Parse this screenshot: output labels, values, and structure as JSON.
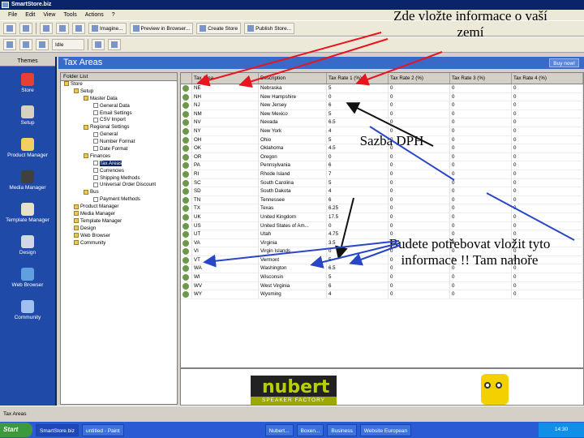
{
  "window": {
    "title": "SmartStore.biz"
  },
  "menu": [
    "File",
    "Edit",
    "View",
    "Tools",
    "Actions",
    "?"
  ],
  "toolbar1": {
    "buttons": [
      "Imagine...",
      "Preview in Browser...",
      "Create Store",
      "Publish Store..."
    ]
  },
  "toolbar2": {
    "dropdown": "Idle"
  },
  "leftnav": {
    "tab": "Themes",
    "items": [
      "Store",
      "Setup",
      "Product Manager",
      "Media Manager",
      "Template Manager",
      "Design",
      "Web Browser",
      "Community"
    ]
  },
  "panel": {
    "title": "Tax Areas",
    "now_button": "Buy now!"
  },
  "tree": {
    "header": "Folder List",
    "nodes": [
      {
        "label": "Store",
        "depth": 0,
        "type": "folder"
      },
      {
        "label": "Setup",
        "depth": 1,
        "type": "folder"
      },
      {
        "label": "Master Data",
        "depth": 2,
        "type": "folder"
      },
      {
        "label": "General Data",
        "depth": 3,
        "type": "doc"
      },
      {
        "label": "Email Settings",
        "depth": 3,
        "type": "doc"
      },
      {
        "label": "CSV Import",
        "depth": 3,
        "type": "doc"
      },
      {
        "label": "Regional Settings",
        "depth": 2,
        "type": "folder"
      },
      {
        "label": "General",
        "depth": 3,
        "type": "doc"
      },
      {
        "label": "Number Format",
        "depth": 3,
        "type": "doc"
      },
      {
        "label": "Date Format",
        "depth": 3,
        "type": "doc"
      },
      {
        "label": "Finances",
        "depth": 2,
        "type": "folder"
      },
      {
        "label": "Tax Areas",
        "depth": 3,
        "type": "doc",
        "selected": true
      },
      {
        "label": "Currencies",
        "depth": 3,
        "type": "doc"
      },
      {
        "label": "Shipping Methods",
        "depth": 3,
        "type": "doc"
      },
      {
        "label": "Universal Order Discount",
        "depth": 3,
        "type": "doc"
      },
      {
        "label": "Bus",
        "depth": 2,
        "type": "folder"
      },
      {
        "label": "Payment Methods",
        "depth": 3,
        "type": "doc"
      },
      {
        "label": "Product Manager",
        "depth": 1,
        "type": "folder"
      },
      {
        "label": "Media Manager",
        "depth": 1,
        "type": "folder"
      },
      {
        "label": "Template Manager",
        "depth": 1,
        "type": "folder"
      },
      {
        "label": "Design",
        "depth": 1,
        "type": "folder"
      },
      {
        "label": "Web Browser",
        "depth": 1,
        "type": "folder"
      },
      {
        "label": "Community",
        "depth": 1,
        "type": "folder"
      }
    ]
  },
  "grid": {
    "columns": [
      "",
      "Tax Area",
      "Description",
      "Tax Rate 1 (%)",
      "Tax Rate 2 (%)",
      "Tax Rate 3 (%)",
      "Tax Rate 4 (%)"
    ],
    "rows": [
      [
        "NE",
        "Nebraska",
        "5",
        "0",
        "0",
        "0"
      ],
      [
        "NH",
        "New Hampshire",
        "0",
        "0",
        "0",
        "0"
      ],
      [
        "NJ",
        "New Jersey",
        "6",
        "0",
        "0",
        "0"
      ],
      [
        "NM",
        "New Mexico",
        "5",
        "0",
        "0",
        "0"
      ],
      [
        "NV",
        "Nevada",
        "6.5",
        "0",
        "0",
        "0"
      ],
      [
        "NY",
        "New York",
        "4",
        "0",
        "0",
        "0"
      ],
      [
        "OH",
        "Ohio",
        "5",
        "0",
        "0",
        "0"
      ],
      [
        "OK",
        "Oklahoma",
        "4.5",
        "0",
        "0",
        "0"
      ],
      [
        "OR",
        "Oregon",
        "0",
        "0",
        "0",
        "0"
      ],
      [
        "PA",
        "Pennsylvania",
        "6",
        "0",
        "0",
        "0"
      ],
      [
        "RI",
        "Rhode Island",
        "7",
        "0",
        "0",
        "0"
      ],
      [
        "SC",
        "South Carolina",
        "5",
        "0",
        "0",
        "0"
      ],
      [
        "SD",
        "South Dakota",
        "4",
        "0",
        "0",
        "0"
      ],
      [
        "TN",
        "Tennessee",
        "6",
        "0",
        "0",
        "0"
      ],
      [
        "TX",
        "Texas",
        "6.25",
        "0",
        "0",
        "0"
      ],
      [
        "UK",
        "United Kingdom",
        "17.5",
        "0",
        "0",
        "0"
      ],
      [
        "US",
        "United States of Am...",
        "0",
        "0",
        "0",
        "0"
      ],
      [
        "UT",
        "Utah",
        "4.75",
        "0",
        "0",
        "0"
      ],
      [
        "VA",
        "Virginia",
        "3.5",
        "0",
        "0",
        "0"
      ],
      [
        "VI",
        "Virgin Islands",
        "0",
        "0",
        "0",
        "0"
      ],
      [
        "VT",
        "Vermont",
        "5",
        "0",
        "0",
        "0"
      ],
      [
        "WA",
        "Washington",
        "6.5",
        "0",
        "0",
        "0"
      ],
      [
        "WI",
        "Wisconsin",
        "5",
        "0",
        "0",
        "0"
      ],
      [
        "WV",
        "West Virginia",
        "6",
        "0",
        "0",
        "0"
      ],
      [
        "WY",
        "Wyoming",
        "4",
        "0",
        "0",
        "0"
      ]
    ]
  },
  "ad": {
    "brand": "nubert",
    "tagline": "SPEAKER FACTORY"
  },
  "statusbar": {
    "text": "Tax Areas"
  },
  "taskbar": {
    "start": "Start",
    "tasks": [
      "SmartStore.biz",
      "untitled - Paint",
      "Nubert...",
      "Boxen...",
      "Business",
      "Website European"
    ],
    "time": "14:30"
  },
  "annotations": {
    "info": "Zde vložte informace o vaší zemí",
    "vat": "Sazba DPH",
    "need": "Budete potřebovat vložit tyto informace !! Tam nahoře"
  },
  "colors": {
    "arrow_red": "#e8141e",
    "arrow_blue": "#2846c8",
    "titlebar": "#0a246a",
    "nav_bg": "#1f4aa8"
  }
}
